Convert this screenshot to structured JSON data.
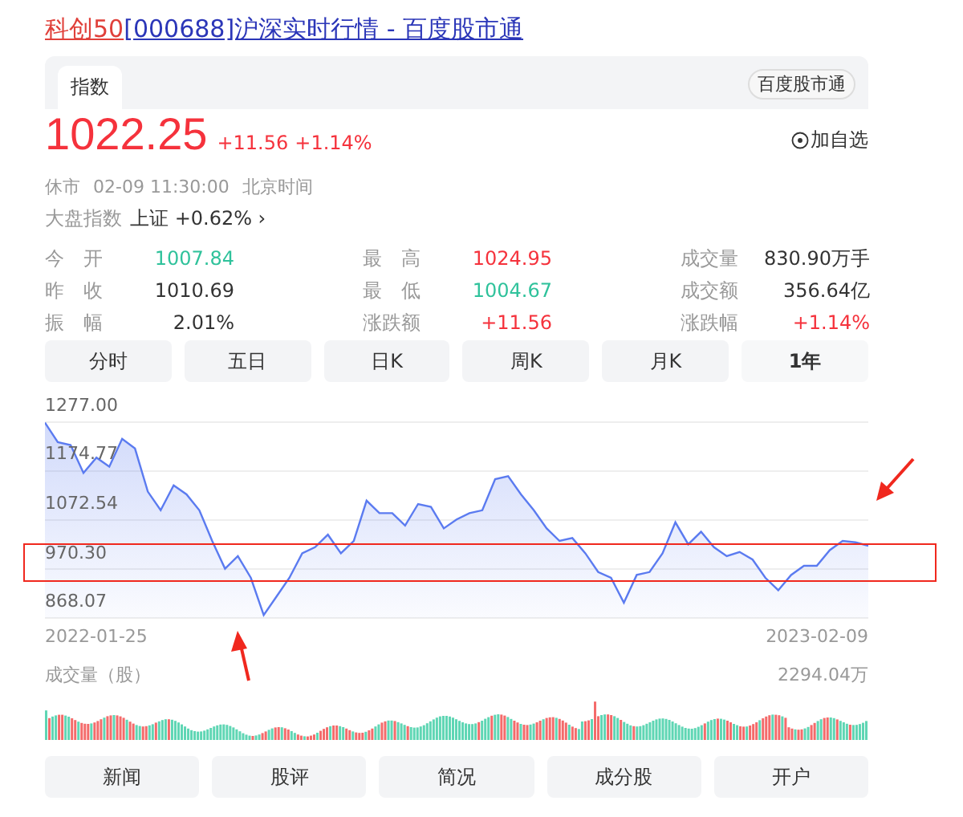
{
  "title": {
    "name": "科创50",
    "rest": "[000688]沪深实时行情 - 百度股市通"
  },
  "tabs": [
    {
      "label": "指数",
      "selected": true
    }
  ],
  "badge": "百度股市通",
  "quote": {
    "price": "1022.25",
    "change": "+11.56",
    "percent": "+1.14%",
    "watch": "加自选"
  },
  "status": {
    "state": "休市",
    "time": "02-09 11:30:00",
    "zone": "北京时间"
  },
  "market": {
    "label": "大盘指数",
    "index": "上证",
    "change": "+0.62%",
    "arrow": "›"
  },
  "stats": [
    {
      "label": "今　开",
      "value": "1007.84",
      "color": "#2fc29b"
    },
    {
      "label": "最　高",
      "value": "1024.95",
      "color": "#f5323c"
    },
    {
      "label": "成交量",
      "value": "830.90万手",
      "color": "#333333"
    },
    {
      "label": "昨　收",
      "value": "1010.69",
      "color": "#333333"
    },
    {
      "label": "最　低",
      "value": "1004.67",
      "color": "#2fc29b"
    },
    {
      "label": "成交额",
      "value": "356.64亿",
      "color": "#333333"
    },
    {
      "label": "振　幅",
      "value": "2.01%",
      "color": "#333333"
    },
    {
      "label": "涨跌额",
      "value": "+11.56",
      "color": "#f5323c"
    },
    {
      "label": "涨跌幅",
      "value": "+1.14%",
      "color": "#f5323c"
    }
  ],
  "periods": [
    {
      "label": "分时",
      "selected": false
    },
    {
      "label": "五日",
      "selected": false
    },
    {
      "label": "日K",
      "selected": false
    },
    {
      "label": "周K",
      "selected": false
    },
    {
      "label": "月K",
      "selected": false
    },
    {
      "label": "1年",
      "selected": true
    }
  ],
  "chart": {
    "start_date": "2022-01-25",
    "end_date": "2023-02-09",
    "chart_data": {
      "type": "area",
      "grid": true,
      "ylim": [
        868.07,
        1277
      ],
      "yticks": [
        {
          "value": 1277,
          "label": "1277.00"
        },
        {
          "value": 1174.77,
          "label": "1174.77"
        },
        {
          "value": 1072.54,
          "label": "1072.54"
        },
        {
          "value": 970.3,
          "label": "970.30"
        },
        {
          "value": 868.07,
          "label": "868.07"
        }
      ],
      "series": [
        {
          "color": "#5b7bf0",
          "values": [
            1276,
            1235,
            1229,
            1171,
            1203,
            1184,
            1242,
            1222,
            1132,
            1093,
            1145,
            1126,
            1093,
            1029,
            971,
            997,
            952,
            874,
            913,
            952,
            1003,
            1016,
            1042,
            1003,
            1029,
            1113,
            1087,
            1087,
            1061,
            1106,
            1100,
            1055,
            1074,
            1087,
            1093,
            1158,
            1164,
            1126,
            1093,
            1055,
            1029,
            1035,
            1003,
            964,
            952,
            900,
            958,
            964,
            1003,
            1068,
            1022,
            1048,
            1016,
            997,
            1006,
            990,
            952,
            926,
            958,
            977,
            977,
            1010,
            1029,
            1026,
            1019
          ]
        }
      ]
    }
  },
  "volume": {
    "label": "成交量（股）",
    "max": "2294.04万"
  },
  "links": [
    "新闻",
    "股评",
    "简况",
    "成分股",
    "开户"
  ]
}
